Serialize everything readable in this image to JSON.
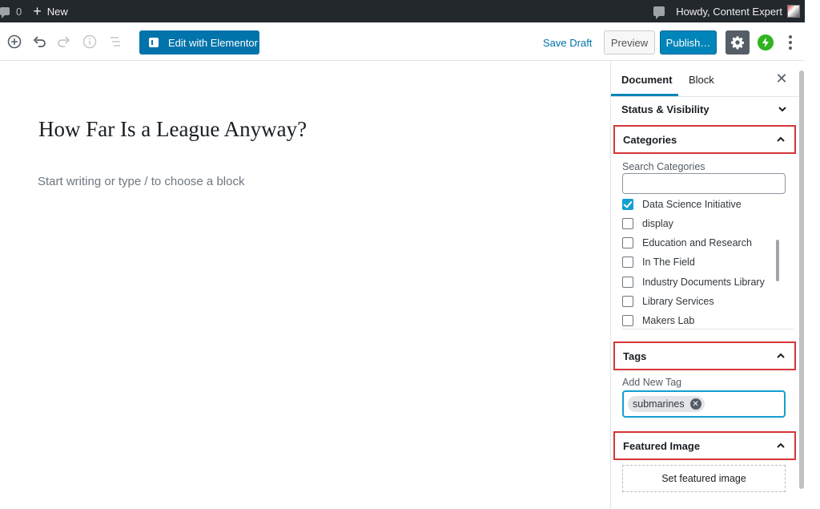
{
  "admin_bar": {
    "comment_count": "0",
    "new_label": "New",
    "howdy": "Howdy, Content Expert"
  },
  "toolbar": {
    "elementor_label": "Edit with Elementor",
    "save_draft_label": "Save Draft",
    "preview_label": "Preview",
    "publish_label": "Publish…",
    "icons": [
      "add-block-icon",
      "undo-icon",
      "redo-icon",
      "info-icon",
      "outline-icon",
      "gear-icon",
      "jetpack-icon",
      "more-icon"
    ]
  },
  "editor": {
    "title": "How Far Is a League Anyway?",
    "placeholder": "Start writing or type / to choose a block"
  },
  "sidebar": {
    "tabs": [
      {
        "label": "Document",
        "active": true
      },
      {
        "label": "Block",
        "active": false
      }
    ],
    "status_panel": "Status & Visibility",
    "categories_panel": {
      "title": "Categories",
      "search_label": "Search Categories",
      "search_value": "",
      "items": [
        {
          "label": "Data Science Initiative",
          "checked": true
        },
        {
          "label": "display",
          "checked": false
        },
        {
          "label": "Education and Research",
          "checked": false
        },
        {
          "label": "In The Field",
          "checked": false
        },
        {
          "label": "Industry Documents Library",
          "checked": false
        },
        {
          "label": "Library Services",
          "checked": false
        },
        {
          "label": "Makers Lab",
          "checked": false
        }
      ]
    },
    "tags_panel": {
      "title": "Tags",
      "add_label": "Add New Tag",
      "tokens": [
        "submarines"
      ]
    },
    "featured_panel": {
      "title": "Featured Image",
      "button_label": "Set featured image"
    }
  },
  "colors": {
    "accent": "#0085ba",
    "admin_bar": "#23282d",
    "highlight_outline": "#d63638",
    "checkbox_checked": "#11a0d2",
    "jetpack": "#2fb41f"
  }
}
